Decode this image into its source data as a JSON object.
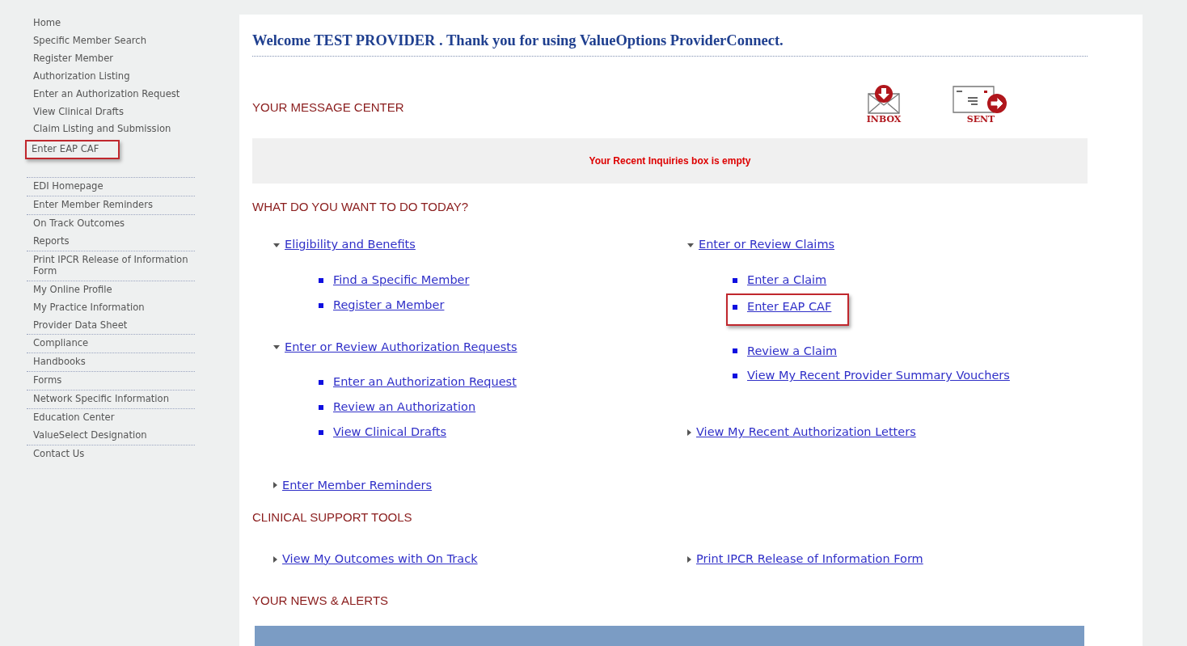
{
  "sidebar": {
    "items": [
      {
        "label": "Home",
        "divider_below": false,
        "highlighted": false
      },
      {
        "label": "Specific Member Search",
        "divider_below": false,
        "highlighted": false
      },
      {
        "label": "Register Member",
        "divider_below": false,
        "highlighted": false
      },
      {
        "label": "Authorization Listing",
        "divider_below": false,
        "highlighted": false
      },
      {
        "label": "Enter an Authorization Request",
        "divider_below": false,
        "highlighted": false
      },
      {
        "label": "View Clinical Drafts",
        "divider_below": false,
        "highlighted": false
      },
      {
        "label": "Claim Listing and Submission",
        "divider_below": false,
        "highlighted": false
      },
      {
        "label": "Enter EAP CAF",
        "divider_below": false,
        "highlighted": true
      }
    ],
    "items_2": [
      {
        "label": "EDI Homepage",
        "divider_below": true,
        "highlighted": false
      },
      {
        "label": "Enter Member Reminders",
        "divider_below": true,
        "highlighted": false
      },
      {
        "label": "On Track Outcomes",
        "divider_below": false,
        "highlighted": false
      },
      {
        "label": "Reports",
        "divider_below": true,
        "highlighted": false
      },
      {
        "label": "Print IPCR Release of Information Form",
        "divider_below": true,
        "highlighted": false
      },
      {
        "label": "My Online Profile",
        "divider_below": false,
        "highlighted": false
      },
      {
        "label": "My Practice Information",
        "divider_below": false,
        "highlighted": false
      },
      {
        "label": "Provider Data Sheet",
        "divider_below": true,
        "highlighted": false
      },
      {
        "label": "Compliance",
        "divider_below": true,
        "highlighted": false
      },
      {
        "label": "Handbooks",
        "divider_below": true,
        "highlighted": false
      },
      {
        "label": "Forms",
        "divider_below": true,
        "highlighted": false
      },
      {
        "label": "Network Specific Information",
        "divider_below": true,
        "highlighted": false
      },
      {
        "label": "Education Center",
        "divider_below": false,
        "highlighted": false
      },
      {
        "label": "ValueSelect Designation",
        "divider_below": true,
        "highlighted": false
      },
      {
        "label": "Contact Us",
        "divider_below": false,
        "highlighted": false
      }
    ]
  },
  "welcome": "Welcome TEST PROVIDER . Thank you for using ValueOptions ProviderConnect.",
  "message_center": {
    "heading": "YOUR MESSAGE CENTER",
    "buttons": [
      {
        "kind": "inbox",
        "label": "INBOX"
      },
      {
        "kind": "sent",
        "label": "SENT"
      }
    ],
    "empty_message": "Your Recent Inquiries box is empty"
  },
  "todo": {
    "heading": "WHAT DO YOU WANT TO DO TODAY?",
    "columns": [
      [
        {
          "label": "Eligibility and Benefits",
          "expanded": true,
          "children": [
            {
              "label": "Find a Specific Member",
              "highlighted": false
            },
            {
              "label": "Register a Member",
              "highlighted": false
            }
          ]
        },
        {
          "label": "Enter or Review Authorization Requests",
          "expanded": true,
          "children": [
            {
              "label": "Enter an Authorization Request",
              "highlighted": false
            },
            {
              "label": "Review an Authorization",
              "highlighted": false
            },
            {
              "label": "View Clinical Drafts",
              "highlighted": false
            }
          ]
        },
        {
          "label": "Enter Member Reminders",
          "expanded": false
        }
      ],
      [
        {
          "label": "Enter or Review Claims",
          "expanded": true,
          "children": [
            {
              "label": "Enter a Claim",
              "highlighted": false
            },
            {
              "label": "Enter EAP CAF",
              "highlighted": true
            },
            {
              "label": "Review a Claim",
              "highlighted": false
            },
            {
              "label": "View My Recent Provider Summary Vouchers",
              "highlighted": false
            }
          ]
        },
        {
          "label": "View My Recent Authorization Letters",
          "expanded": false
        }
      ]
    ]
  },
  "clinical": {
    "heading": "CLINICAL SUPPORT TOOLS",
    "links": [
      {
        "label": "View My Outcomes with On Track",
        "expanded": false
      },
      {
        "label": "Print IPCR Release of Information Form",
        "expanded": false
      }
    ]
  },
  "news": {
    "heading": "YOUR NEWS & ALERTS"
  }
}
